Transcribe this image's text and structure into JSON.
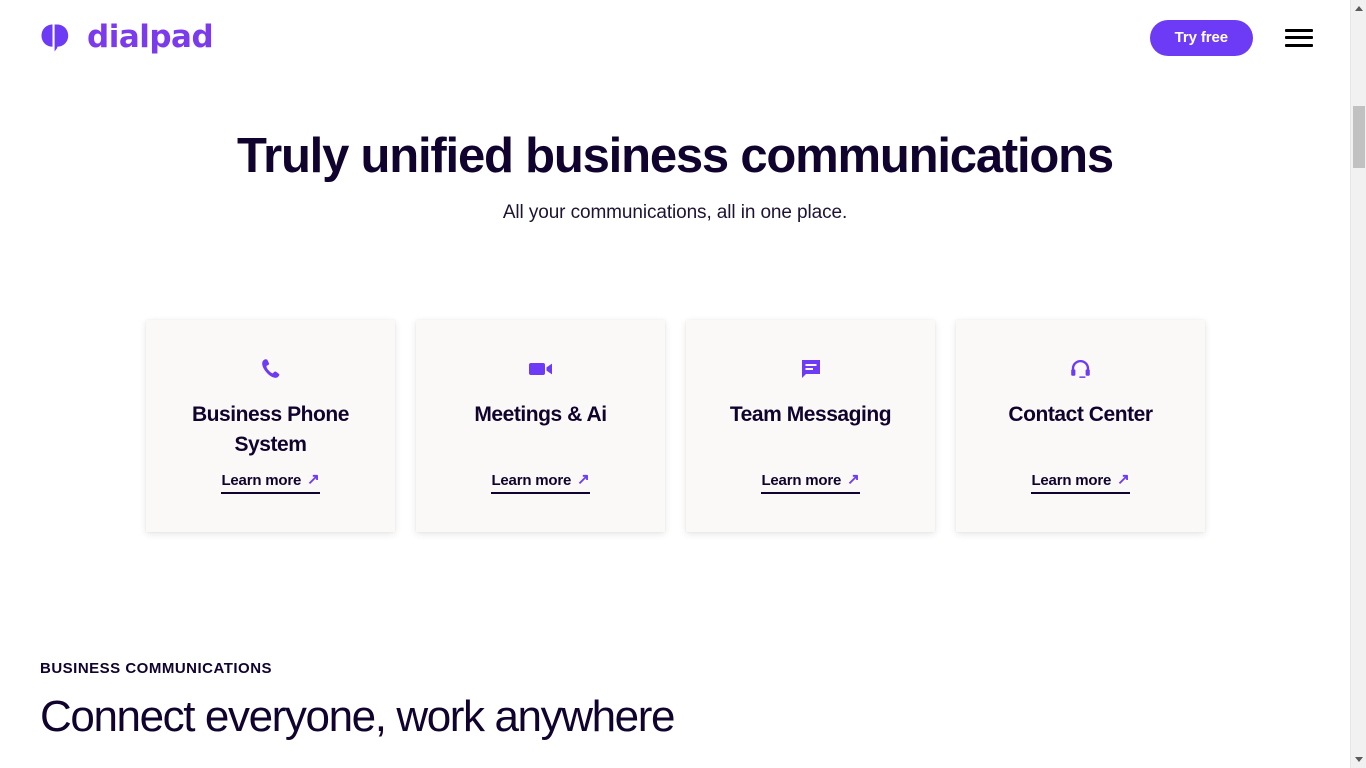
{
  "header": {
    "logo_mark_icon": "dialpad-logo-mark",
    "logo_text": "dialpad",
    "try_free_label": "Try free",
    "menu_icon": "hamburger-menu-icon"
  },
  "hero": {
    "title": "Truly unified business communications",
    "subtitle": "All your communications, all in one place."
  },
  "cards": [
    {
      "icon": "phone-icon",
      "title": "Business Phone System",
      "link_label": "Learn more",
      "link_arrow": "↗"
    },
    {
      "icon": "video-camera-icon",
      "title": "Meetings & Ai",
      "link_label": "Learn more",
      "link_arrow": "↗"
    },
    {
      "icon": "chat-bubble-icon",
      "title": "Team Messaging",
      "link_label": "Learn more",
      "link_arrow": "↗"
    },
    {
      "icon": "headset-icon",
      "title": "Contact Center",
      "link_label": "Learn more",
      "link_arrow": "↗"
    }
  ],
  "section": {
    "eyebrow": "BUSINESS COMMUNICATIONS",
    "title": "Connect everyone, work anywhere"
  },
  "colors": {
    "brand_purple": "#6d3bf5",
    "text_dark": "#10032e",
    "card_bg": "#faf9f7",
    "page_bg": "#ffffff"
  }
}
